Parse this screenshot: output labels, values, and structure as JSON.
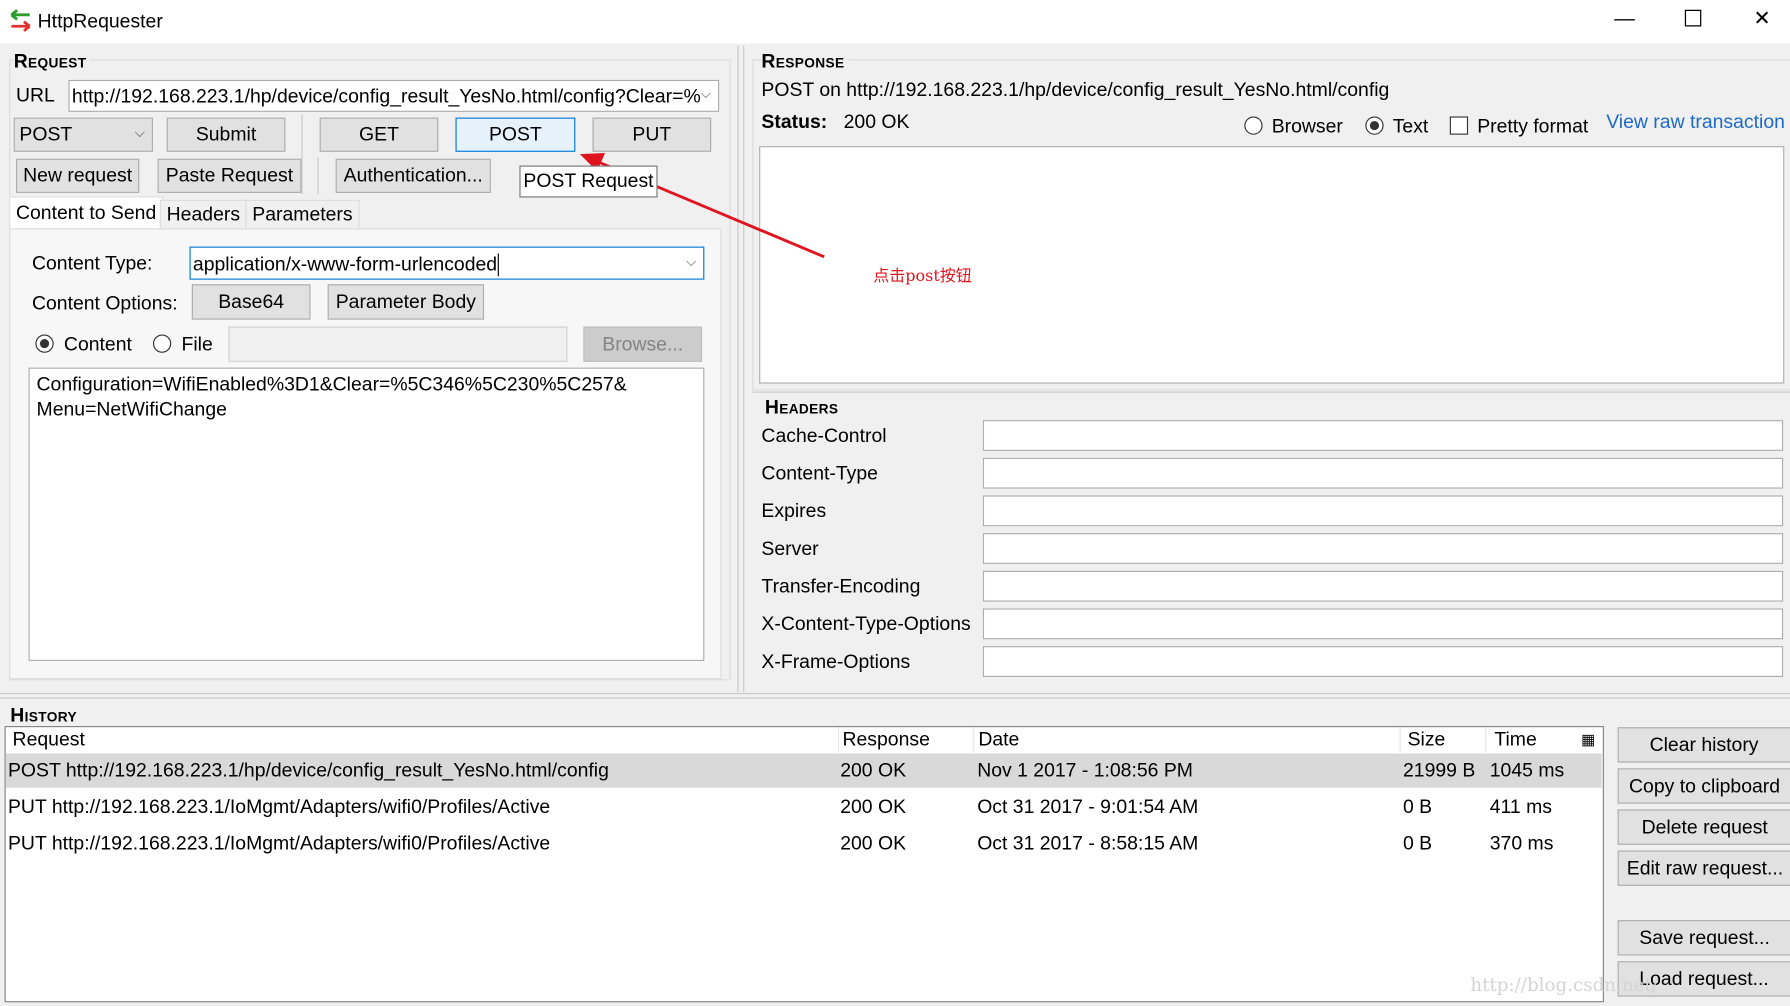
{
  "window": {
    "title": "HttpRequester",
    "minimize": "—",
    "maximize": "☐",
    "close": "✕"
  },
  "request": {
    "section_label": "Request",
    "url_label": "URL",
    "url_value": "http://192.168.223.1/hp/device/config_result_YesNo.html/config?Clear=%",
    "method_value": "POST",
    "submit": "Submit",
    "get": "GET",
    "post": "POST",
    "put": "PUT",
    "new_request": "New request",
    "paste_request": "Paste Request",
    "authentication": "Authentication...",
    "tooltip": "POST Request",
    "tabs": [
      {
        "label": "Content to Send",
        "selected": true
      },
      {
        "label": "Headers"
      },
      {
        "label": "Parameters"
      }
    ],
    "content_type_label": "Content Type:",
    "content_type_value": "application/x-www-form-urlencoded",
    "content_options_label": "Content Options:",
    "base64": "Base64",
    "parameter_body": "Parameter Body",
    "radio_content": "Content",
    "radio_file": "File",
    "file_path": "",
    "browse": "Browse...",
    "body_lines": [
      "Configuration=WifiEnabled%3D1&Clear=%5C346%5C230%5C257&",
      "Menu=NetWifiChange"
    ]
  },
  "annotation": {
    "text": "点击post按钮",
    "color": "#e0141e"
  },
  "response": {
    "section_label": "Response",
    "summary": "POST on http://192.168.223.1/hp/device/config_result_YesNo.html/config",
    "status_label": "Status:",
    "status_value": "200 OK",
    "browser": "Browser",
    "text": "Text",
    "selected_view": "Text",
    "pretty_format": "Pretty format",
    "pretty_checked": false,
    "view_raw": "View raw transaction",
    "link_color": "#1e6ac8"
  },
  "headers": {
    "section_label": "Headers",
    "items": [
      "Cache-Control",
      "Content-Type",
      "Expires",
      "Server",
      "Transfer-Encoding",
      "X-Content-Type-Options",
      "X-Frame-Options"
    ]
  },
  "history": {
    "section_label": "History",
    "columns": [
      "Request",
      "Response",
      "Date",
      "Size",
      "Time"
    ],
    "rows": [
      {
        "request": "POST http://192.168.223.1/hp/device/config_result_YesNo.html/config",
        "response": "200 OK",
        "date": "Nov 1 2017 - 1:08:56 PM",
        "size": "21999 B",
        "time": "1045 ms",
        "selected": true
      },
      {
        "request": "PUT http://192.168.223.1/IoMgmt/Adapters/wifi0/Profiles/Active",
        "response": "200 OK",
        "date": "Oct 31 2017 - 9:01:54 AM",
        "size": "0 B",
        "time": "411 ms"
      },
      {
        "request": "PUT http://192.168.223.1/IoMgmt/Adapters/wifi0/Profiles/Active",
        "response": "200 OK",
        "date": "Oct 31 2017 - 8:58:15 AM",
        "size": "0 B",
        "time": "370 ms"
      }
    ],
    "buttons": [
      "Clear history",
      "Copy to clipboard",
      "Delete request",
      "Edit raw request...",
      "Save request...",
      "Load request..."
    ]
  },
  "watermark": "http://blog.csdn.net/"
}
